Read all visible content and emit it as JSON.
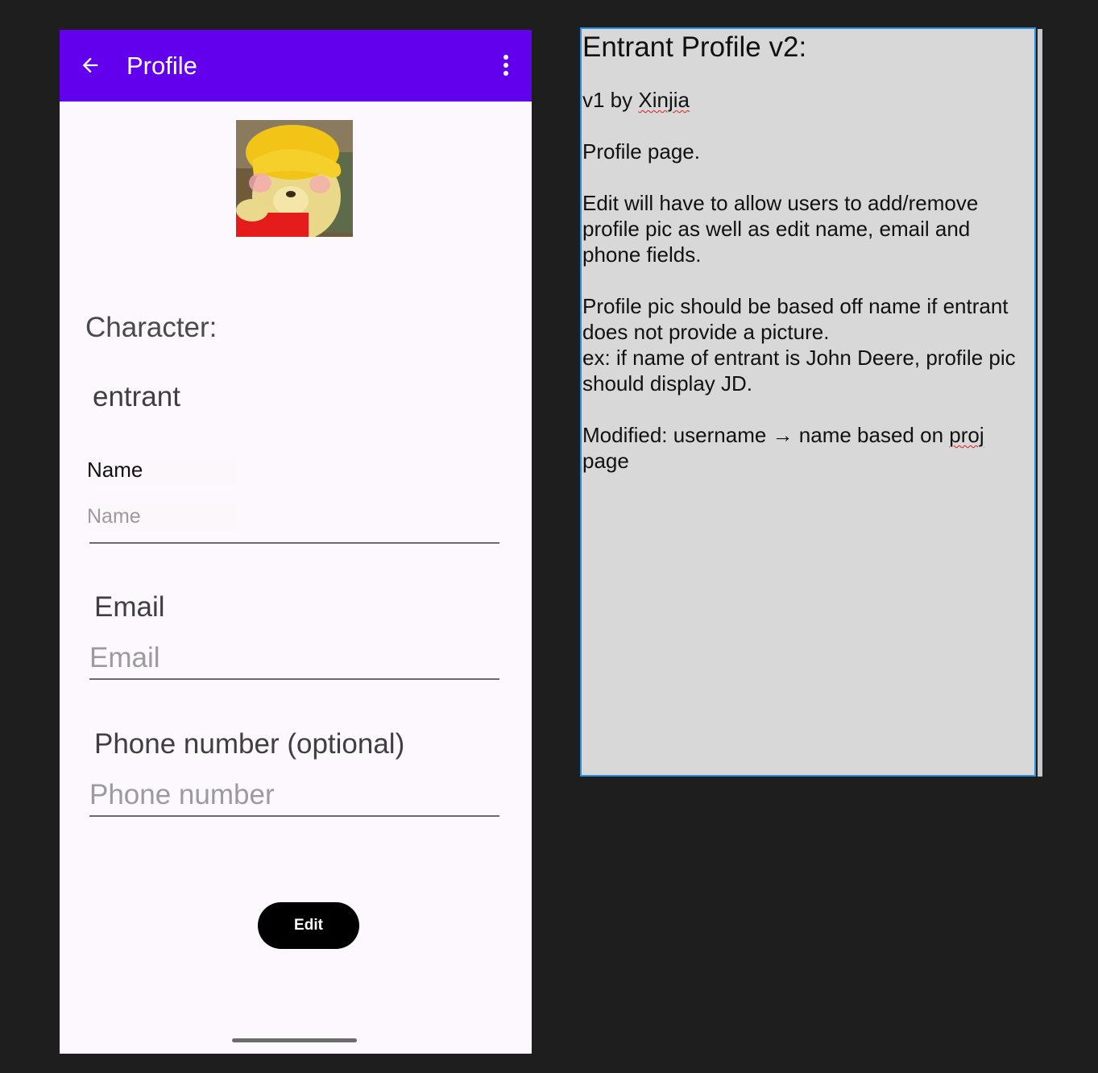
{
  "app": {
    "title": "Profile",
    "character_label": "Character:",
    "character_value": "entrant",
    "name": {
      "label": "Name",
      "placeholder": "Name",
      "value": ""
    },
    "email": {
      "label": "Email",
      "placeholder": "Email",
      "value": ""
    },
    "phone": {
      "label": "Phone number (optional)",
      "placeholder": "Phone number",
      "value": ""
    },
    "edit_label": "Edit",
    "icons": {
      "back": "back-arrow-icon",
      "more": "more-vertical-icon"
    },
    "colors": {
      "appbar": "#6200ee",
      "background": "#fdf7fe",
      "button": "#000000"
    }
  },
  "note": {
    "title": "Entrant Profile v2:",
    "line_v1_prefix": "v1 by ",
    "line_v1_author": "Xinjia",
    "line_profile_page": "Profile page.",
    "line_edit": "Edit will have to allow users to add/remove profile pic as well as edit name, email and phone fields.",
    "line_pic_1": "Profile pic should be based off name if entrant does not provide a picture.",
    "line_pic_2": "ex: if name of entrant is John Deere, profile pic should display JD.",
    "line_modified_prefix": "Modified: username → name based on ",
    "line_modified_word": "proj",
    "line_modified_suffix": " page"
  }
}
